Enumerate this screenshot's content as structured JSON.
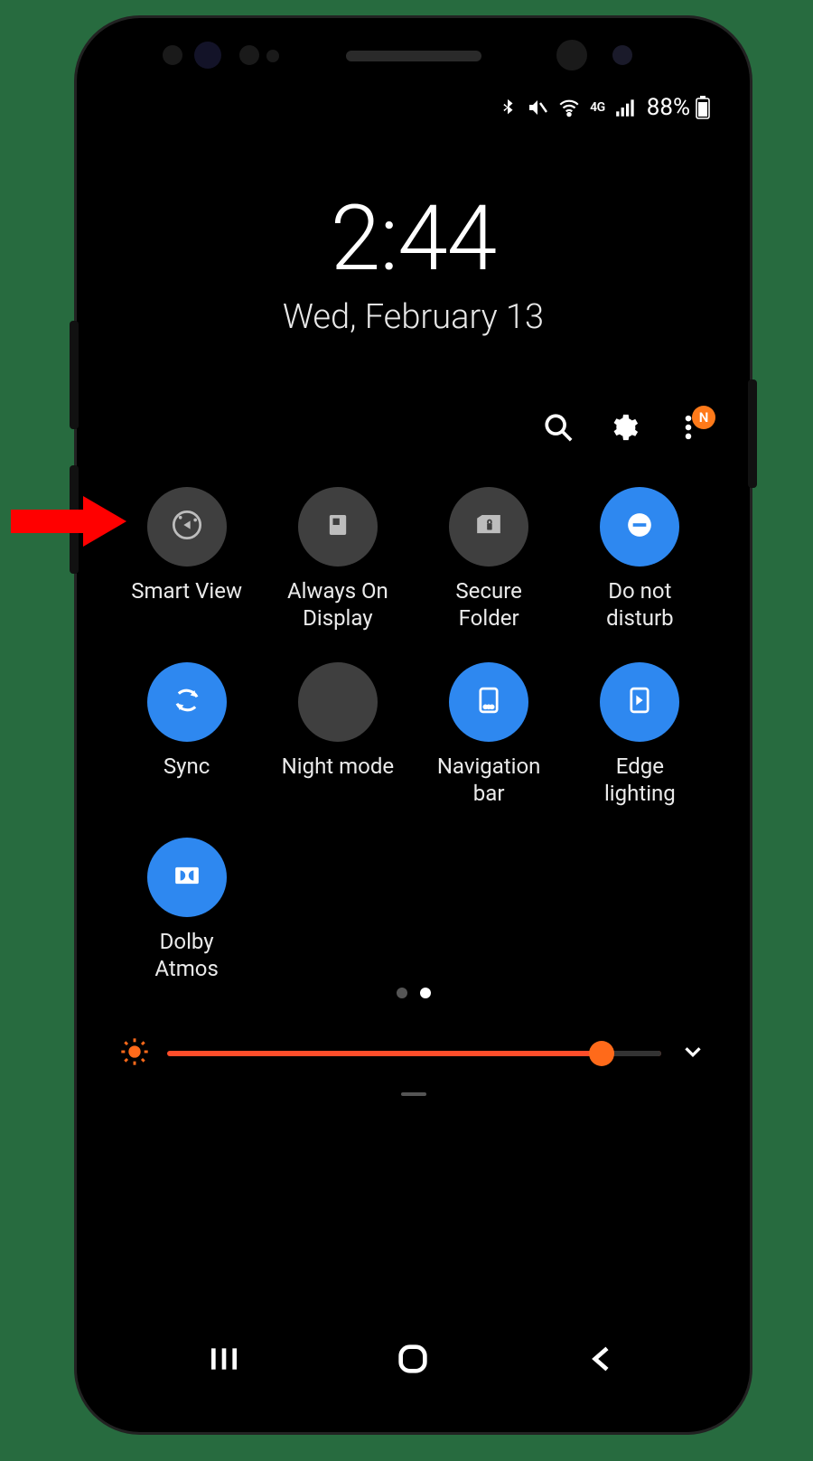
{
  "status": {
    "network_label": "4G",
    "battery_pct": "88%"
  },
  "clock": {
    "time": "2:44",
    "date": "Wed, February 13"
  },
  "badge": {
    "letter": "N"
  },
  "tiles": [
    {
      "label": "Smart View",
      "state": "off",
      "icon": "smart-view"
    },
    {
      "label": "Always On\nDisplay",
      "state": "off",
      "icon": "always-on-display"
    },
    {
      "label": "Secure\nFolder",
      "state": "off",
      "icon": "secure-folder"
    },
    {
      "label": "Do not\ndisturb",
      "state": "on",
      "icon": "do-not-disturb"
    },
    {
      "label": "Sync",
      "state": "on",
      "icon": "sync"
    },
    {
      "label": "Night mode",
      "state": "off",
      "icon": "night-mode"
    },
    {
      "label": "Navigation\nbar",
      "state": "on",
      "icon": "navigation-bar"
    },
    {
      "label": "Edge\nlighting",
      "state": "on",
      "icon": "edge-lighting"
    },
    {
      "label": "Dolby\nAtmos",
      "state": "on",
      "icon": "dolby-atmos"
    }
  ],
  "pages": {
    "count": 2,
    "active": 1
  },
  "brightness": {
    "value": 88,
    "max": 100
  },
  "colors": {
    "accent_blue": "#2e88f0",
    "accent_orange": "#ff6a1a",
    "tile_off": "#3f3f3f",
    "annotation_red": "#ff0000"
  }
}
